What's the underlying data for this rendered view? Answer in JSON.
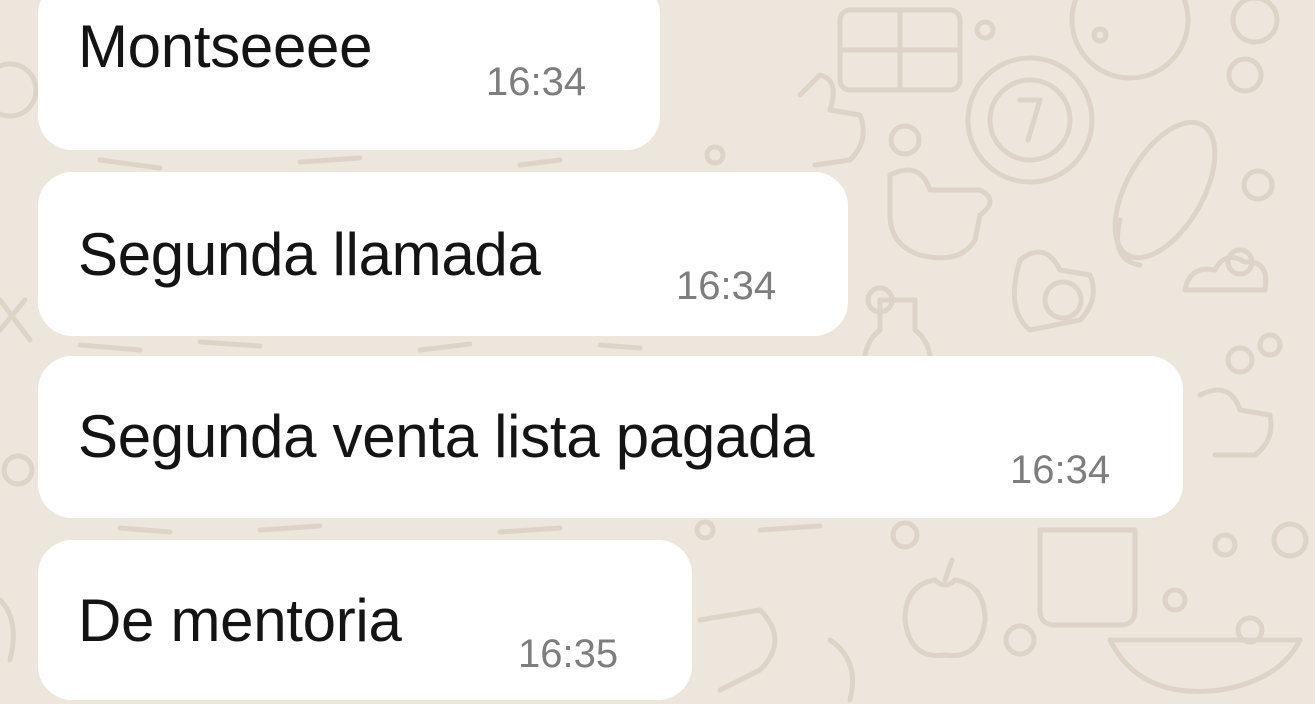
{
  "chat": {
    "messages": [
      {
        "text": "Montseeee",
        "time": "16:34"
      },
      {
        "text": "Segunda llamada",
        "time": "16:34"
      },
      {
        "text": "Segunda venta lista pagada",
        "time": "16:34"
      },
      {
        "text": "De mentoria",
        "time": "16:35"
      }
    ]
  },
  "colors": {
    "wallpaper": "#ede6dc",
    "doodles": "#ddd4c7",
    "bubble": "#ffffff",
    "text": "#141414",
    "timestamp": "#7d7d7d"
  },
  "icons": [
    "doodle-wallpaper-pattern"
  ]
}
